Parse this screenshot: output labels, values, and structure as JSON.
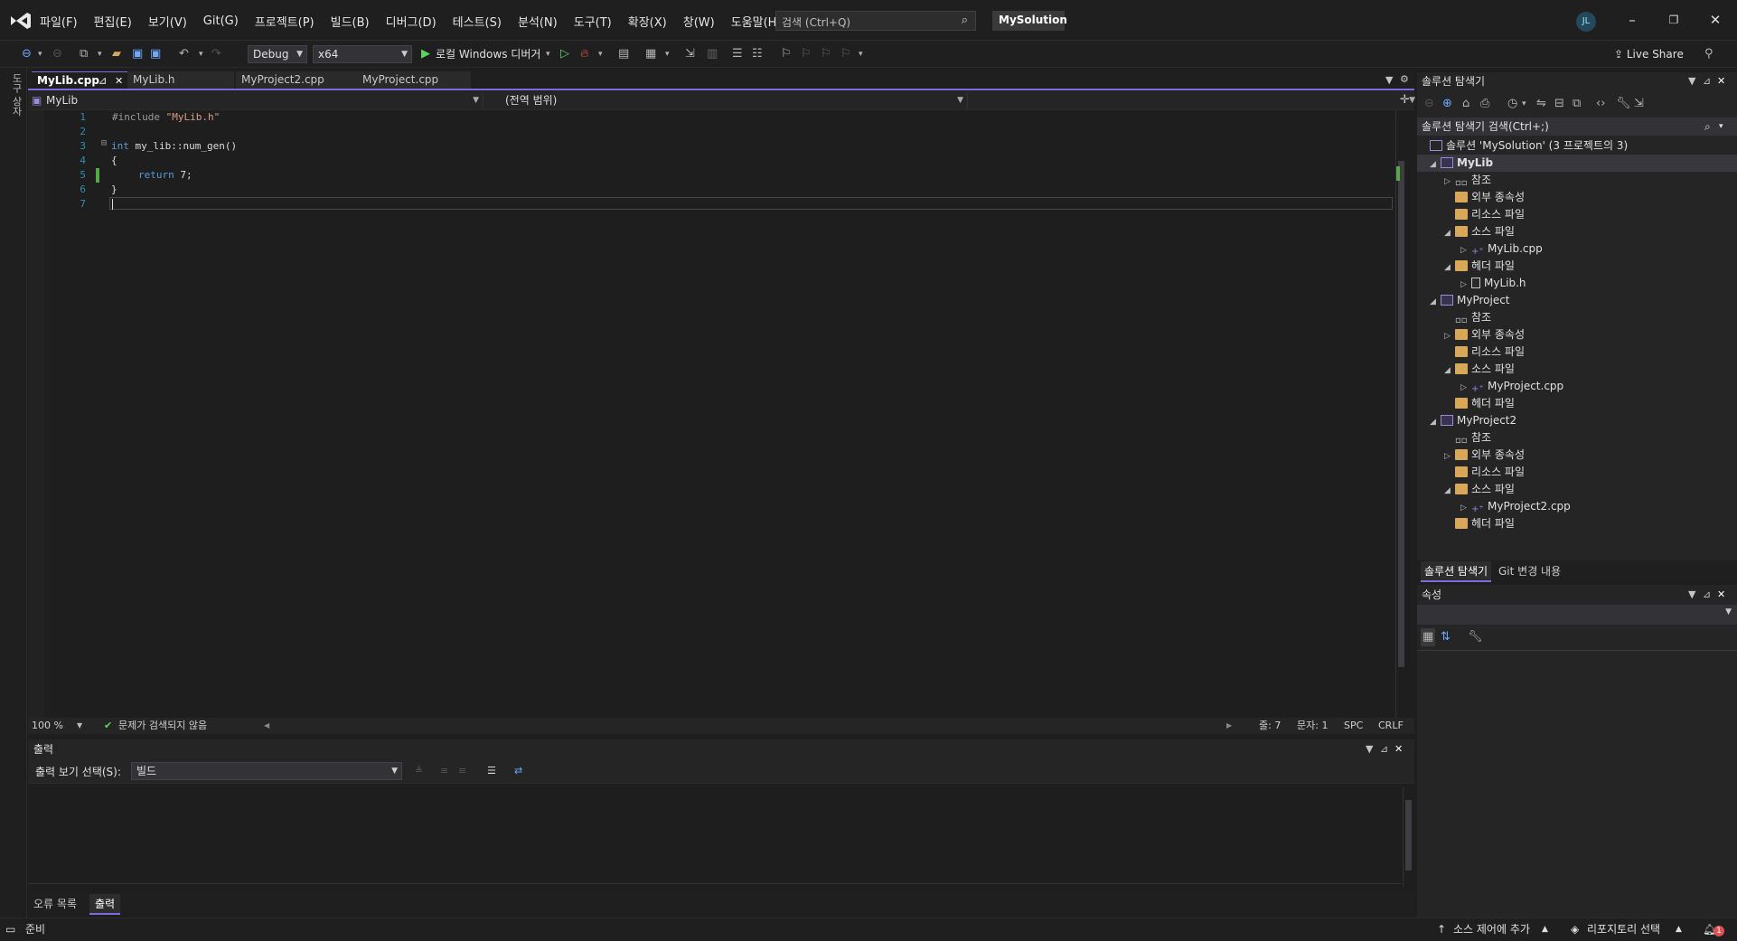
{
  "menu": [
    "파일(F)",
    "편집(E)",
    "보기(V)",
    "Git(G)",
    "프로젝트(P)",
    "빌드(B)",
    "디버그(D)",
    "테스트(S)",
    "분석(N)",
    "도구(T)",
    "확장(X)",
    "창(W)",
    "도움말(H)"
  ],
  "search": {
    "placeholder": "검색 (Ctrl+Q)"
  },
  "solution_name": "MySolution",
  "avatar_initials": "JL",
  "toolbar": {
    "config": "Debug",
    "platform": "x64",
    "run_label": "로컬 Windows 디버거",
    "live_share": "Live Share"
  },
  "left_strip_label": "도구 상자",
  "tabs": [
    {
      "label": "MyLib.cpp",
      "active": true
    },
    {
      "label": "MyLib.h",
      "active": false
    },
    {
      "label": "MyProject2.cpp",
      "active": false
    },
    {
      "label": "MyProject.cpp",
      "active": false
    }
  ],
  "nav": {
    "project": "MyLib",
    "scope": "(전역 범위)"
  },
  "code": {
    "line_numbers": [
      "1",
      "2",
      "3",
      "4",
      "5",
      "6",
      "7"
    ],
    "l1_directive": "#include",
    "l1_string": "\"MyLib.h\"",
    "l3_kw": "int",
    "l3_rest": " my_lib::num_gen()",
    "l4": "{",
    "l5_kw": "return",
    "l5_rest": " 7;",
    "l6": "}"
  },
  "editor_status": {
    "zoom": "100 %",
    "issues": "문제가 검색되지 않음",
    "line": "줄: 7",
    "col": "문자: 1",
    "spc": "SPC",
    "eol": "CRLF"
  },
  "output": {
    "title": "출력",
    "show_label": "출력 보기 선택(S):",
    "show_value": "빌드",
    "tabs": [
      "오류 목록",
      "출력"
    ]
  },
  "solution_explorer": {
    "title": "솔루션 탐색기",
    "search_placeholder": "솔루션 탐색기 검색(Ctrl+;)",
    "root": "솔루션 'MySolution' (3 프로젝트의 3)",
    "tree": [
      {
        "label": "MyLib",
        "level": 1,
        "toggle": "◢",
        "kind": "proj",
        "selected": true
      },
      {
        "label": "참조",
        "level": 2,
        "toggle": "▷",
        "kind": "ref"
      },
      {
        "label": "외부 종속성",
        "level": 2,
        "toggle": "",
        "kind": "folder"
      },
      {
        "label": "리소스 파일",
        "level": 2,
        "toggle": "",
        "kind": "folder"
      },
      {
        "label": "소스 파일",
        "level": 2,
        "toggle": "◢",
        "kind": "folder"
      },
      {
        "label": "MyLib.cpp",
        "level": 3,
        "toggle": "▷",
        "kind": "cpp"
      },
      {
        "label": "헤더 파일",
        "level": 2,
        "toggle": "◢",
        "kind": "folder"
      },
      {
        "label": "MyLib.h",
        "level": 3,
        "toggle": "▷",
        "kind": "h"
      },
      {
        "label": "MyProject",
        "level": 1,
        "toggle": "◢",
        "kind": "proj"
      },
      {
        "label": "참조",
        "level": 2,
        "toggle": "",
        "kind": "ref"
      },
      {
        "label": "외부 종속성",
        "level": 2,
        "toggle": "▷",
        "kind": "folder"
      },
      {
        "label": "리소스 파일",
        "level": 2,
        "toggle": "",
        "kind": "folder"
      },
      {
        "label": "소스 파일",
        "level": 2,
        "toggle": "◢",
        "kind": "folder"
      },
      {
        "label": "MyProject.cpp",
        "level": 3,
        "toggle": "▷",
        "kind": "cpp"
      },
      {
        "label": "헤더 파일",
        "level": 2,
        "toggle": "",
        "kind": "folder"
      },
      {
        "label": "MyProject2",
        "level": 1,
        "toggle": "◢",
        "kind": "proj"
      },
      {
        "label": "참조",
        "level": 2,
        "toggle": "",
        "kind": "ref"
      },
      {
        "label": "외부 종속성",
        "level": 2,
        "toggle": "▷",
        "kind": "folder"
      },
      {
        "label": "리소스 파일",
        "level": 2,
        "toggle": "",
        "kind": "folder"
      },
      {
        "label": "소스 파일",
        "level": 2,
        "toggle": "◢",
        "kind": "folder"
      },
      {
        "label": "MyProject2.cpp",
        "level": 3,
        "toggle": "▷",
        "kind": "cpp"
      },
      {
        "label": "헤더 파일",
        "level": 2,
        "toggle": "",
        "kind": "folder"
      }
    ],
    "bottom_tabs": [
      "솔루션 탐색기",
      "Git 변경 내용"
    ]
  },
  "properties": {
    "title": "속성"
  },
  "statusbar": {
    "ready": "준비",
    "source_control": "소스 제어에 추가",
    "repo": "리포지토리 선택",
    "notif_count": "1"
  },
  "colors": {
    "accent": "#7f6ae0",
    "change_bar": "#57a64a",
    "line_number": "#2b91af"
  }
}
